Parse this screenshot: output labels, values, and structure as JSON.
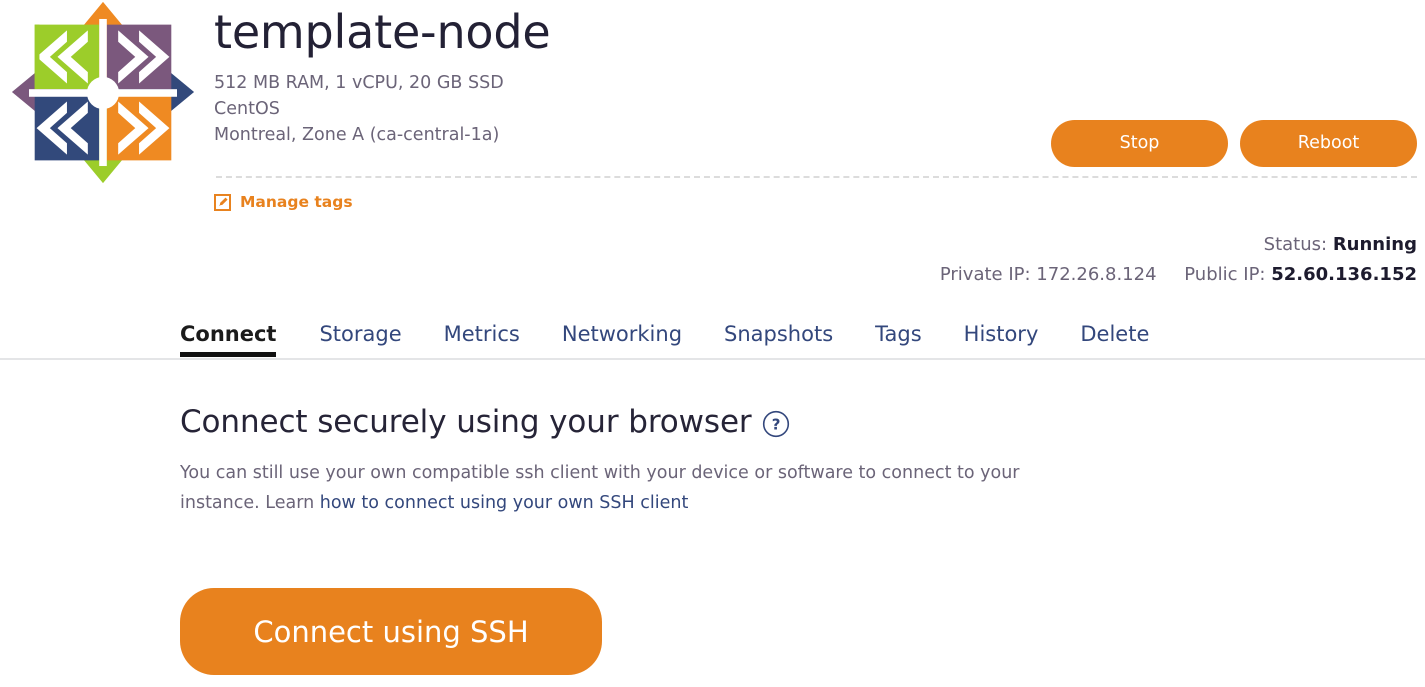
{
  "instance": {
    "name": "template-node",
    "os_logo": "centos-logo",
    "specs": [
      "512 MB RAM, 1 vCPU, 20 GB SSD",
      "CentOS",
      "Montreal, Zone A (ca-central-1a)"
    ],
    "manage_tags_label": "Manage tags",
    "manage_tags_icon": "edit-tag-icon"
  },
  "actions": {
    "stop_label": "Stop",
    "reboot_label": "Reboot"
  },
  "status": {
    "status_label": "Status:",
    "status_value": "Running",
    "private_ip_label": "Private IP:",
    "private_ip_value": "172.26.8.124",
    "public_ip_label": "Public IP:",
    "public_ip_value": "52.60.136.152"
  },
  "tabs": [
    {
      "label": "Connect",
      "active": true
    },
    {
      "label": "Storage",
      "active": false
    },
    {
      "label": "Metrics",
      "active": false
    },
    {
      "label": "Networking",
      "active": false
    },
    {
      "label": "Snapshots",
      "active": false
    },
    {
      "label": "Tags",
      "active": false
    },
    {
      "label": "History",
      "active": false
    },
    {
      "label": "Delete",
      "active": false
    }
  ],
  "connect_panel": {
    "heading": "Connect securely using your browser",
    "help_icon": "question-circle-icon",
    "body_text_before": "You can still use your own compatible ssh client with your device or software to connect to your instance. Learn ",
    "body_link_text": "how to connect using your own SSH client",
    "cta_label": "Connect using SSH"
  },
  "colors": {
    "accent_orange": "#e8821e",
    "link_blue": "#33477c",
    "muted_text": "#6b6478",
    "dark_text": "#232135"
  }
}
